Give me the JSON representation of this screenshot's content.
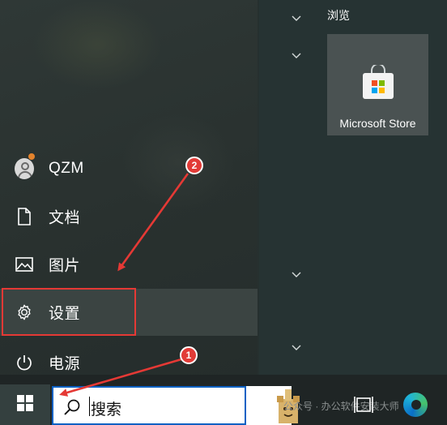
{
  "start_menu": {
    "items": [
      {
        "label": "QZM",
        "icon": "user-avatar-icon"
      },
      {
        "label": "文档",
        "icon": "document-icon"
      },
      {
        "label": "图片",
        "icon": "pictures-icon"
      },
      {
        "label": "设置",
        "icon": "gear-icon"
      },
      {
        "label": "电源",
        "icon": "power-icon"
      }
    ],
    "tiles_group": {
      "title": "浏览",
      "tiles": [
        {
          "label": "Microsoft Store",
          "icon": "microsoft-store-icon"
        }
      ]
    }
  },
  "annotations": {
    "step_1": "1",
    "step_2": "2",
    "color": "#e53935"
  },
  "taskbar": {
    "search_placeholder": "搜索",
    "watermark": "公众号 · 办公软件安装大师"
  },
  "colors": {
    "accent": "#0a61c4",
    "hover": "#3b4442",
    "annotation": "#e53935"
  }
}
